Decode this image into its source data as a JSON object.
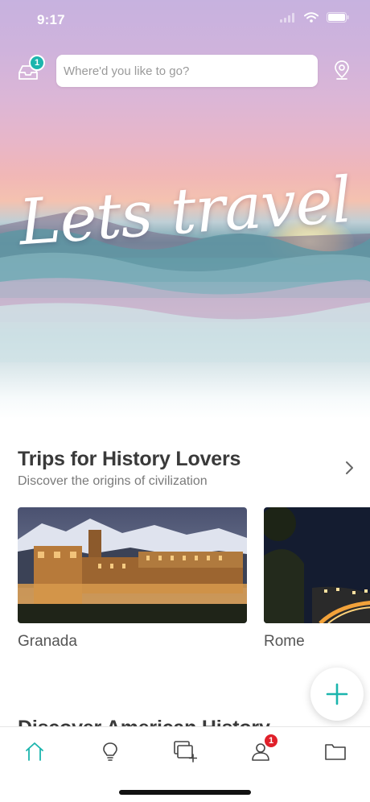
{
  "status_bar": {
    "time": "9:17"
  },
  "header": {
    "inbox_badge": "1",
    "search_placeholder": "Where'd you like to go?"
  },
  "hero": {
    "title": "Lets travel"
  },
  "section_history": {
    "title": "Trips for History Lovers",
    "subtitle": "Discover the origins of civilization",
    "cards": [
      {
        "name": "Granada"
      },
      {
        "name": "Rome"
      }
    ]
  },
  "section_next": {
    "title": "Discover American History"
  },
  "tab_bar": {
    "active_color": "#1bb5ad",
    "profile_badge": "1"
  },
  "colors": {
    "accent": "#1bb5ad",
    "badge_red": "#e0202a"
  }
}
